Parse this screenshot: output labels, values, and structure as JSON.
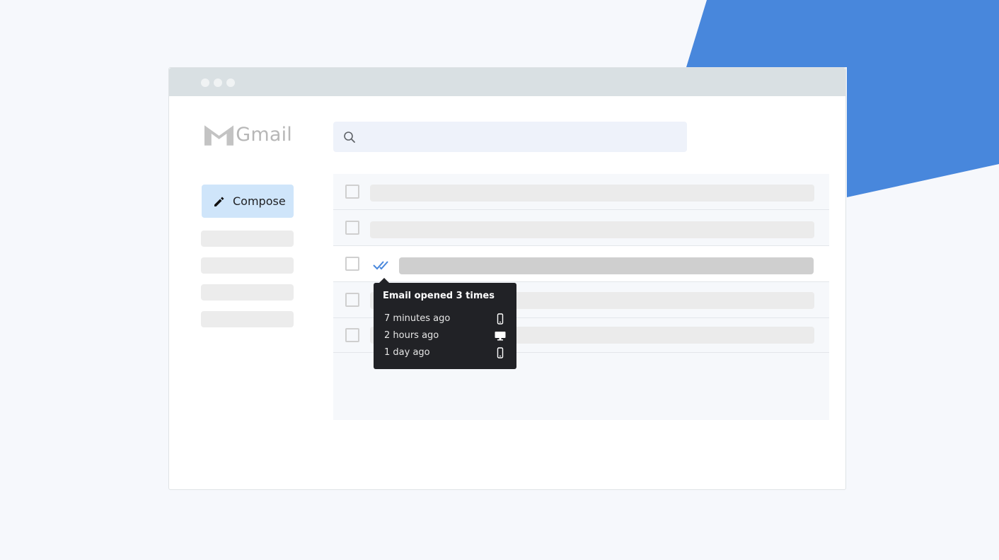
{
  "app": {
    "logo_text": "Gmail"
  },
  "sidebar": {
    "compose_label": "Compose"
  },
  "search": {
    "placeholder": ""
  },
  "tooltip": {
    "title": "Email opened 3 times",
    "opens": [
      {
        "time": "7 minutes ago",
        "device": "mobile-phone-icon"
      },
      {
        "time": "2 hours ago",
        "device": "desktop-monitor-icon"
      },
      {
        "time": "1 day ago",
        "device": "mobile-phone-icon"
      }
    ]
  },
  "colors": {
    "accent": "#4887dc",
    "compose_bg": "#cfe5fa",
    "tooltip_bg": "#212226"
  }
}
